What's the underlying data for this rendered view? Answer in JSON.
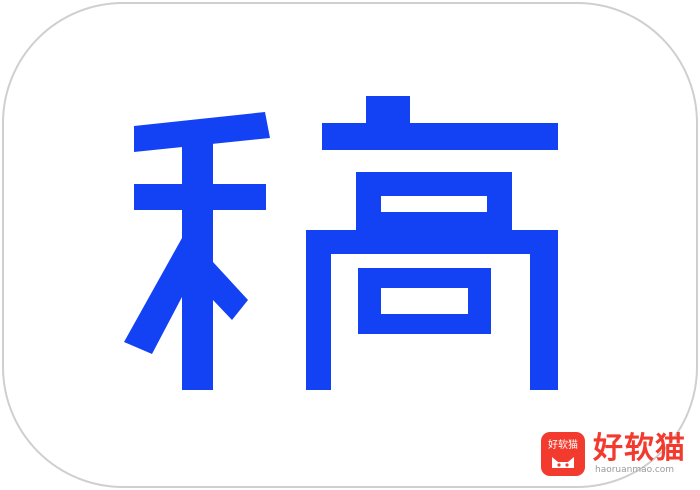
{
  "logo": {
    "glyph": "稿",
    "glyph_color": "#1342f5",
    "background_color": "#ffffff",
    "border_color": "#cfcfcf"
  },
  "watermark": {
    "badge_label": "好软猫",
    "name": "好软猫",
    "url": "haoruanmao.com",
    "accent_color": "#f23b2e"
  }
}
